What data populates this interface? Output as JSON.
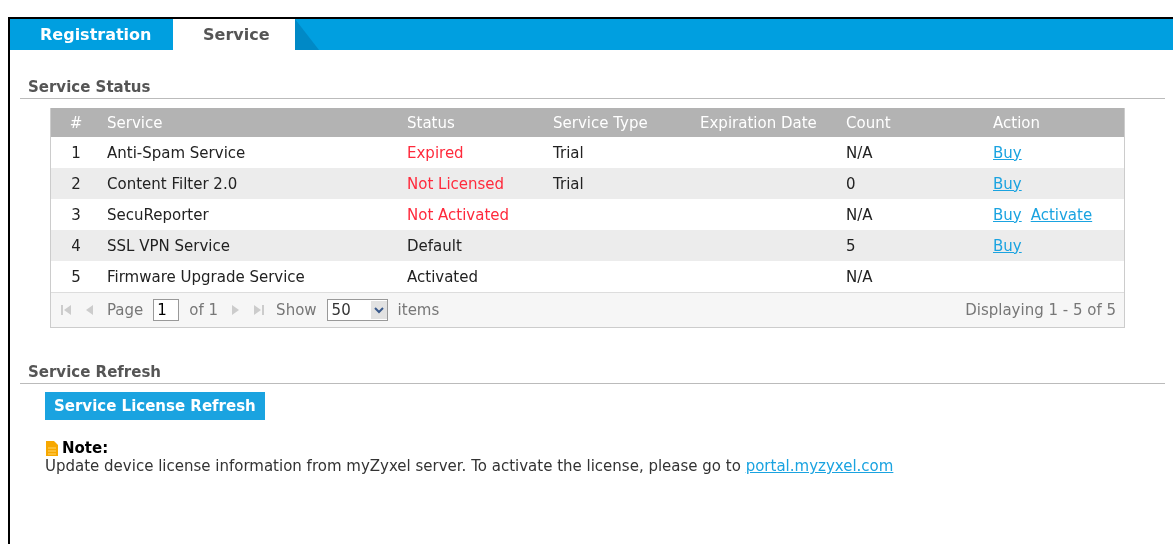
{
  "tabs": [
    {
      "label": "Registration",
      "selected": false
    },
    {
      "label": "Service",
      "selected": true
    }
  ],
  "service_status": {
    "title": "Service Status",
    "table": {
      "columns": [
        "#",
        "Service",
        "Status",
        "Service Type",
        "Expiration Date",
        "Count",
        "Action"
      ],
      "rows": [
        {
          "number": "1",
          "service": "Anti-Spam Service",
          "status": "Expired",
          "status_alert": true,
          "service_type": "Trial",
          "count": "N/A",
          "actions": [
            "Buy"
          ]
        },
        {
          "number": "2",
          "service": "Content Filter 2.0",
          "status": "Not Licensed",
          "status_alert": true,
          "service_type": "Trial",
          "count": "0",
          "actions": [
            "Buy"
          ]
        },
        {
          "number": "3",
          "service": "SecuReporter",
          "status": "Not Activated",
          "status_alert": true,
          "count": "N/A",
          "actions": [
            "Buy",
            "Activate"
          ]
        },
        {
          "number": "4",
          "service": "SSL VPN Service",
          "status": "Default",
          "status_alert": false,
          "count": "5",
          "actions": [
            "Buy"
          ]
        },
        {
          "number": "5",
          "service": "Firmware Upgrade Service",
          "status": "Activated",
          "status_alert": false,
          "count": "N/A",
          "actions": []
        }
      ]
    },
    "pager": {
      "page_label": "Page",
      "page": "1",
      "of_label": "of 1",
      "show_label": "Show",
      "page_size": "50",
      "items_label": "items",
      "summary": "Displaying 1 - 5 of 5",
      "first_disabled": true,
      "prev_disabled": true,
      "next_disabled": true,
      "last_disabled": true
    }
  },
  "service_refresh": {
    "title": "Service Refresh",
    "button": "Service License Refresh",
    "note": {
      "heading": "Note:",
      "text": "Update device license information from myZyxel server. To activate the license, please go to ",
      "link": "portal.myzyxel.com"
    }
  }
}
